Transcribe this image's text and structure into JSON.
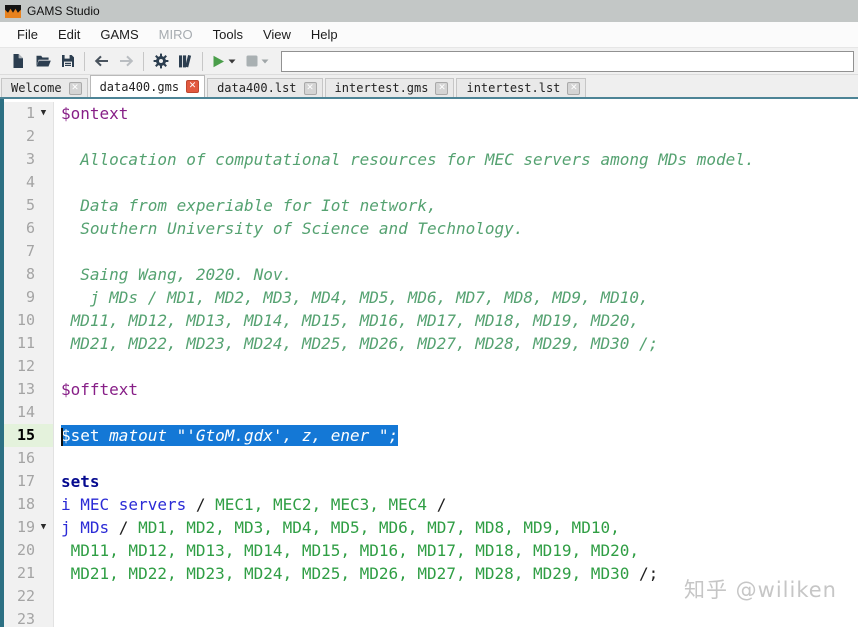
{
  "window": {
    "title": "GAMS Studio"
  },
  "menu_bar": {
    "items": [
      {
        "label": "File",
        "enabled": true
      },
      {
        "label": "Edit",
        "enabled": true
      },
      {
        "label": "GAMS",
        "enabled": true
      },
      {
        "label": "MIRO",
        "enabled": false
      },
      {
        "label": "Tools",
        "enabled": true
      },
      {
        "label": "View",
        "enabled": true
      },
      {
        "label": "Help",
        "enabled": true
      }
    ]
  },
  "toolbar": {
    "buttons": [
      "new-file-icon",
      "open-file-icon",
      "save-icon",
      "back-arrow-icon",
      "forward-arrow-icon",
      "settings-gear-icon",
      "model-library-icon",
      "run-icon",
      "stop-icon"
    ],
    "command_input": {
      "value": "",
      "placeholder": ""
    }
  },
  "tab_bar": {
    "tabs": [
      {
        "label": "Welcome",
        "active": false
      },
      {
        "label": "data400.gms",
        "active": true
      },
      {
        "label": "data400.lst",
        "active": false
      },
      {
        "label": "intertest.gms",
        "active": false
      },
      {
        "label": "intertest.lst",
        "active": false
      }
    ]
  },
  "editor": {
    "lines": [
      {
        "n": 1,
        "fold": true,
        "segs": [
          {
            "t": "$ontext",
            "s": "dir"
          }
        ]
      },
      {
        "n": 2,
        "segs": []
      },
      {
        "n": 3,
        "segs": [
          {
            "t": "  Allocation of computational resources for MEC servers among MDs model.",
            "s": "com"
          }
        ]
      },
      {
        "n": 4,
        "segs": []
      },
      {
        "n": 5,
        "segs": [
          {
            "t": "  Data from experiable for Iot network,",
            "s": "com"
          }
        ]
      },
      {
        "n": 6,
        "segs": [
          {
            "t": "  Southern University of Science and Technology.",
            "s": "com"
          }
        ]
      },
      {
        "n": 7,
        "segs": []
      },
      {
        "n": 8,
        "segs": [
          {
            "t": "  Saing Wang, 2020. Nov.",
            "s": "com"
          }
        ]
      },
      {
        "n": 9,
        "segs": [
          {
            "t": "   j MDs / MD1, MD2, MD3, MD4, MD5, MD6, MD7, MD8, MD9, MD10,",
            "s": "com"
          }
        ]
      },
      {
        "n": 10,
        "segs": [
          {
            "t": " MD11, MD12, MD13, MD14, MD15, MD16, MD17, MD18, MD19, MD20,",
            "s": "com"
          }
        ]
      },
      {
        "n": 11,
        "segs": [
          {
            "t": " MD21, MD22, MD23, MD24, MD25, MD26, MD27, MD28, MD29, MD30 /;",
            "s": "com"
          }
        ]
      },
      {
        "n": 12,
        "segs": []
      },
      {
        "n": 13,
        "segs": [
          {
            "t": "$offtext",
            "s": "dir"
          }
        ]
      },
      {
        "n": 14,
        "segs": []
      },
      {
        "n": 15,
        "selected": true,
        "segs": [
          {
            "t": "$set ",
            "s": "seln"
          },
          {
            "t": "matout \"'GtoM.gdx', z, ener \";",
            "s": "seli"
          }
        ]
      },
      {
        "n": 16,
        "segs": []
      },
      {
        "n": 17,
        "segs": [
          {
            "t": "sets",
            "s": "sets"
          }
        ]
      },
      {
        "n": 18,
        "segs": [
          {
            "t": "i MEC servers",
            "s": "kw"
          },
          {
            "t": " / ",
            "s": "pl"
          },
          {
            "t": "MEC1, MEC2, MEC3, MEC4",
            "s": "el"
          },
          {
            "t": " /",
            "s": "pl"
          }
        ]
      },
      {
        "n": 19,
        "fold": true,
        "segs": [
          {
            "t": "j MDs",
            "s": "kw"
          },
          {
            "t": " / ",
            "s": "pl"
          },
          {
            "t": "MD1, MD2, MD3, MD4, MD5, MD6, MD7, MD8, MD9, MD10,",
            "s": "el"
          }
        ]
      },
      {
        "n": 20,
        "segs": [
          {
            "t": " MD11, MD12, MD13, MD14, MD15, MD16, MD17, MD18, MD19, MD20,",
            "s": "el"
          }
        ]
      },
      {
        "n": 21,
        "segs": [
          {
            "t": " MD21, MD22, MD23, MD24, MD25, MD26, MD27, MD28, MD29, MD30",
            "s": "el"
          },
          {
            "t": " /;",
            "s": "pl"
          }
        ]
      },
      {
        "n": 22,
        "segs": []
      },
      {
        "n": 23,
        "segs": []
      }
    ]
  },
  "watermark": {
    "text": "知乎 @wiliken"
  },
  "colors": {
    "selection": "#1478d6",
    "accent_teal": "#2c7083",
    "tab_underline": "#4d8496",
    "active_tab_close": "#e2593f",
    "run_green": "#4a9e4a",
    "directive": "#871f87",
    "comment": "#55a271",
    "identifier": "#2b2bd6",
    "set_element": "#2f9e44",
    "keyword": "#050a8f"
  }
}
